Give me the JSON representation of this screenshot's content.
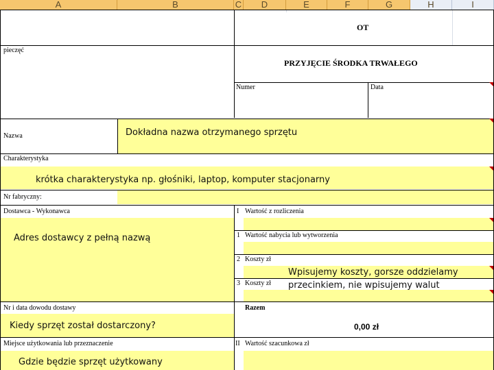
{
  "columns": [
    "A",
    "B",
    "C",
    "D",
    "E",
    "F",
    "G",
    "H",
    "I"
  ],
  "form": {
    "code": "OT",
    "stamp_label": "pieczęć",
    "title": "PRZYJĘCIE ŚRODKA TRWAŁEGO",
    "number_label": "Numer",
    "date_label": "Data",
    "name_label": "Nazwa",
    "name_value": "Dokładna nazwa otrzymanego sprzętu",
    "characteristic_label": "Charakterystyka",
    "characteristic_value": "krótka charakterystyka np. głośniki, laptop, komputer stacjonarny",
    "serial_label": "Nr fabryczny:",
    "supplier_label": "Dostawca - Wykonawca",
    "supplier_value": "Adres dostawcy z pełną nazwą",
    "delivery_doc_label": "Nr i data dowodu dostawy",
    "delivery_doc_value": "Kiedy sprzęt został dostarczony?",
    "usage_place_label": "Miejsce użytkowania lub przeznaczenie",
    "usage_place_value": "Gdzie będzie sprzęt użytkowany",
    "values": [
      {
        "num": "I",
        "label": "Wartość z rozliczenia"
      },
      {
        "num": "1",
        "label": "Wartość nabycia lub wytworzenia"
      },
      {
        "num": "2",
        "label": "Koszty zł"
      },
      {
        "num": "3",
        "label": "Koszty zł"
      }
    ],
    "costs_note_line1": "Wpisujemy koszty, gorsze oddzielamy",
    "costs_note_line2": "przecinkiem, nie wpisujemy walut",
    "total_label": "Razem",
    "total_value": "0,00 zł",
    "estimated_num": "II",
    "estimated_label": "Wartość szacunkowa zł"
  }
}
